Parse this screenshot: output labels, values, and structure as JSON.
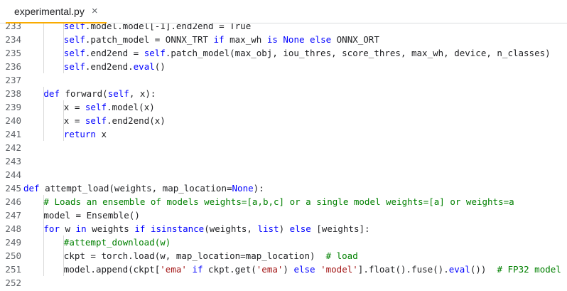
{
  "tab": {
    "title": "experimental.py",
    "close_label": "×"
  },
  "lines": [
    {
      "n": "233",
      "indent": 2,
      "tokens": [
        [
          "slf",
          "self"
        ],
        [
          "",
          "."
        ],
        [
          "",
          "model"
        ],
        [
          "",
          "."
        ],
        [
          "",
          "model[-1].end2end = True"
        ]
      ]
    },
    {
      "n": "234",
      "indent": 2,
      "tokens": [
        [
          "slf",
          "self"
        ],
        [
          "",
          ".patch_model = ONNX_TRT "
        ],
        [
          "kw",
          "if"
        ],
        [
          "",
          " max_wh "
        ],
        [
          "kw",
          "is None else"
        ],
        [
          "",
          " ONNX_ORT"
        ]
      ]
    },
    {
      "n": "235",
      "indent": 2,
      "tokens": [
        [
          "slf",
          "self"
        ],
        [
          "",
          ".end2end = "
        ],
        [
          "slf",
          "self"
        ],
        [
          "",
          ".patch_model(max_obj, iou_thres, score_thres, max_wh, device, n_classes)"
        ]
      ]
    },
    {
      "n": "236",
      "indent": 2,
      "tokens": [
        [
          "slf",
          "self"
        ],
        [
          "",
          ".end2end."
        ],
        [
          "kw",
          "eval"
        ],
        [
          "",
          "()"
        ]
      ]
    },
    {
      "n": "237",
      "indent": 0,
      "tokens": []
    },
    {
      "n": "238",
      "indent": 1,
      "tokens": [
        [
          "kw",
          "def"
        ],
        [
          "",
          " forward("
        ],
        [
          "slf",
          "self"
        ],
        [
          "",
          ", x):"
        ]
      ]
    },
    {
      "n": "239",
      "indent": 2,
      "tokens": [
        [
          "",
          "x = "
        ],
        [
          "slf",
          "self"
        ],
        [
          "",
          ".model(x)"
        ]
      ]
    },
    {
      "n": "240",
      "indent": 2,
      "tokens": [
        [
          "",
          "x = "
        ],
        [
          "slf",
          "self"
        ],
        [
          "",
          ".end2end(x)"
        ]
      ]
    },
    {
      "n": "241",
      "indent": 2,
      "tokens": [
        [
          "kw",
          "return"
        ],
        [
          "",
          " x"
        ]
      ]
    },
    {
      "n": "242",
      "indent": 0,
      "tokens": []
    },
    {
      "n": "243",
      "indent": 0,
      "tokens": []
    },
    {
      "n": "244",
      "indent": 0,
      "tokens": []
    },
    {
      "n": "245",
      "indent": 0,
      "tokens": [
        [
          "kw",
          "def"
        ],
        [
          "",
          " attempt_load(weights, map_location="
        ],
        [
          "kw",
          "None"
        ],
        [
          "",
          "):"
        ]
      ]
    },
    {
      "n": "246",
      "indent": 1,
      "tokens": [
        [
          "cm",
          "# Loads an ensemble of models weights=[a,b,c] or a single model weights=[a] or weights=a"
        ]
      ]
    },
    {
      "n": "247",
      "indent": 1,
      "tokens": [
        [
          "",
          "model = Ensemble()"
        ]
      ]
    },
    {
      "n": "248",
      "indent": 1,
      "tokens": [
        [
          "kw",
          "for"
        ],
        [
          "",
          " w "
        ],
        [
          "kw",
          "in"
        ],
        [
          "",
          " weights "
        ],
        [
          "kw",
          "if"
        ],
        [
          "",
          " "
        ],
        [
          "kw",
          "isinstance"
        ],
        [
          "",
          "(weights, "
        ],
        [
          "kw",
          "list"
        ],
        [
          "",
          ") "
        ],
        [
          "kw",
          "else"
        ],
        [
          "",
          " [weights]:"
        ]
      ]
    },
    {
      "n": "249",
      "indent": 2,
      "tokens": [
        [
          "cm",
          "#attempt_download(w)"
        ]
      ]
    },
    {
      "n": "250",
      "indent": 2,
      "tokens": [
        [
          "",
          "ckpt = torch.load(w, map_location=map_location)  "
        ],
        [
          "cm",
          "# load"
        ]
      ]
    },
    {
      "n": "251",
      "indent": 2,
      "tokens": [
        [
          "",
          "model.append(ckpt["
        ],
        [
          "str",
          "'ema'"
        ],
        [
          "",
          " "
        ],
        [
          "kw",
          "if"
        ],
        [
          "",
          " ckpt.get("
        ],
        [
          "str",
          "'ema'"
        ],
        [
          "",
          ") "
        ],
        [
          "kw",
          "else"
        ],
        [
          "",
          " "
        ],
        [
          "str",
          "'model'"
        ],
        [
          "",
          "].float().fuse()."
        ],
        [
          "kw",
          "eval"
        ],
        [
          "",
          "())  "
        ],
        [
          "cm",
          "# FP32 model"
        ]
      ]
    },
    {
      "n": "252",
      "indent": 0,
      "tokens": []
    }
  ]
}
